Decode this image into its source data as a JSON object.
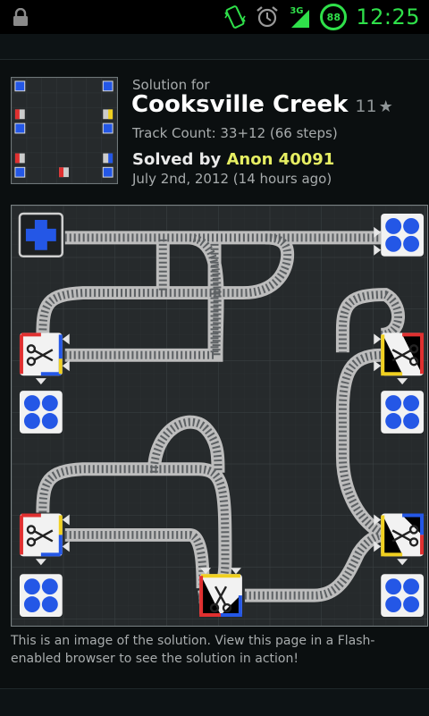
{
  "status_bar": {
    "time": "12:25",
    "network": "3G",
    "battery": "88",
    "icons": [
      "lock-icon",
      "vibrate-icon",
      "alarm-icon",
      "signal-icon",
      "battery-icon"
    ]
  },
  "solution": {
    "kicker": "Solution for",
    "title": "Cooksville Creek",
    "stars": "11",
    "star_icon": "★",
    "track_count": "Track Count: 33+12 (66 steps)",
    "solved_prefix": "Solved by ",
    "solver": "Anon 40091",
    "date": "July 2nd, 2012 (14 hours ago)"
  },
  "caption": "This is an image of the solution. View this page in a Flash-enabled browser to see the solution in action!",
  "colors": {
    "background": "#0b0f10",
    "board": "#262a2c",
    "grid": "#3b4143",
    "accent_green": "#2fe04a",
    "solver_yellow": "#e6ee62",
    "station_blue": "#2457e6",
    "splitter_red": "#e03030",
    "splitter_yellow": "#f0d020"
  }
}
